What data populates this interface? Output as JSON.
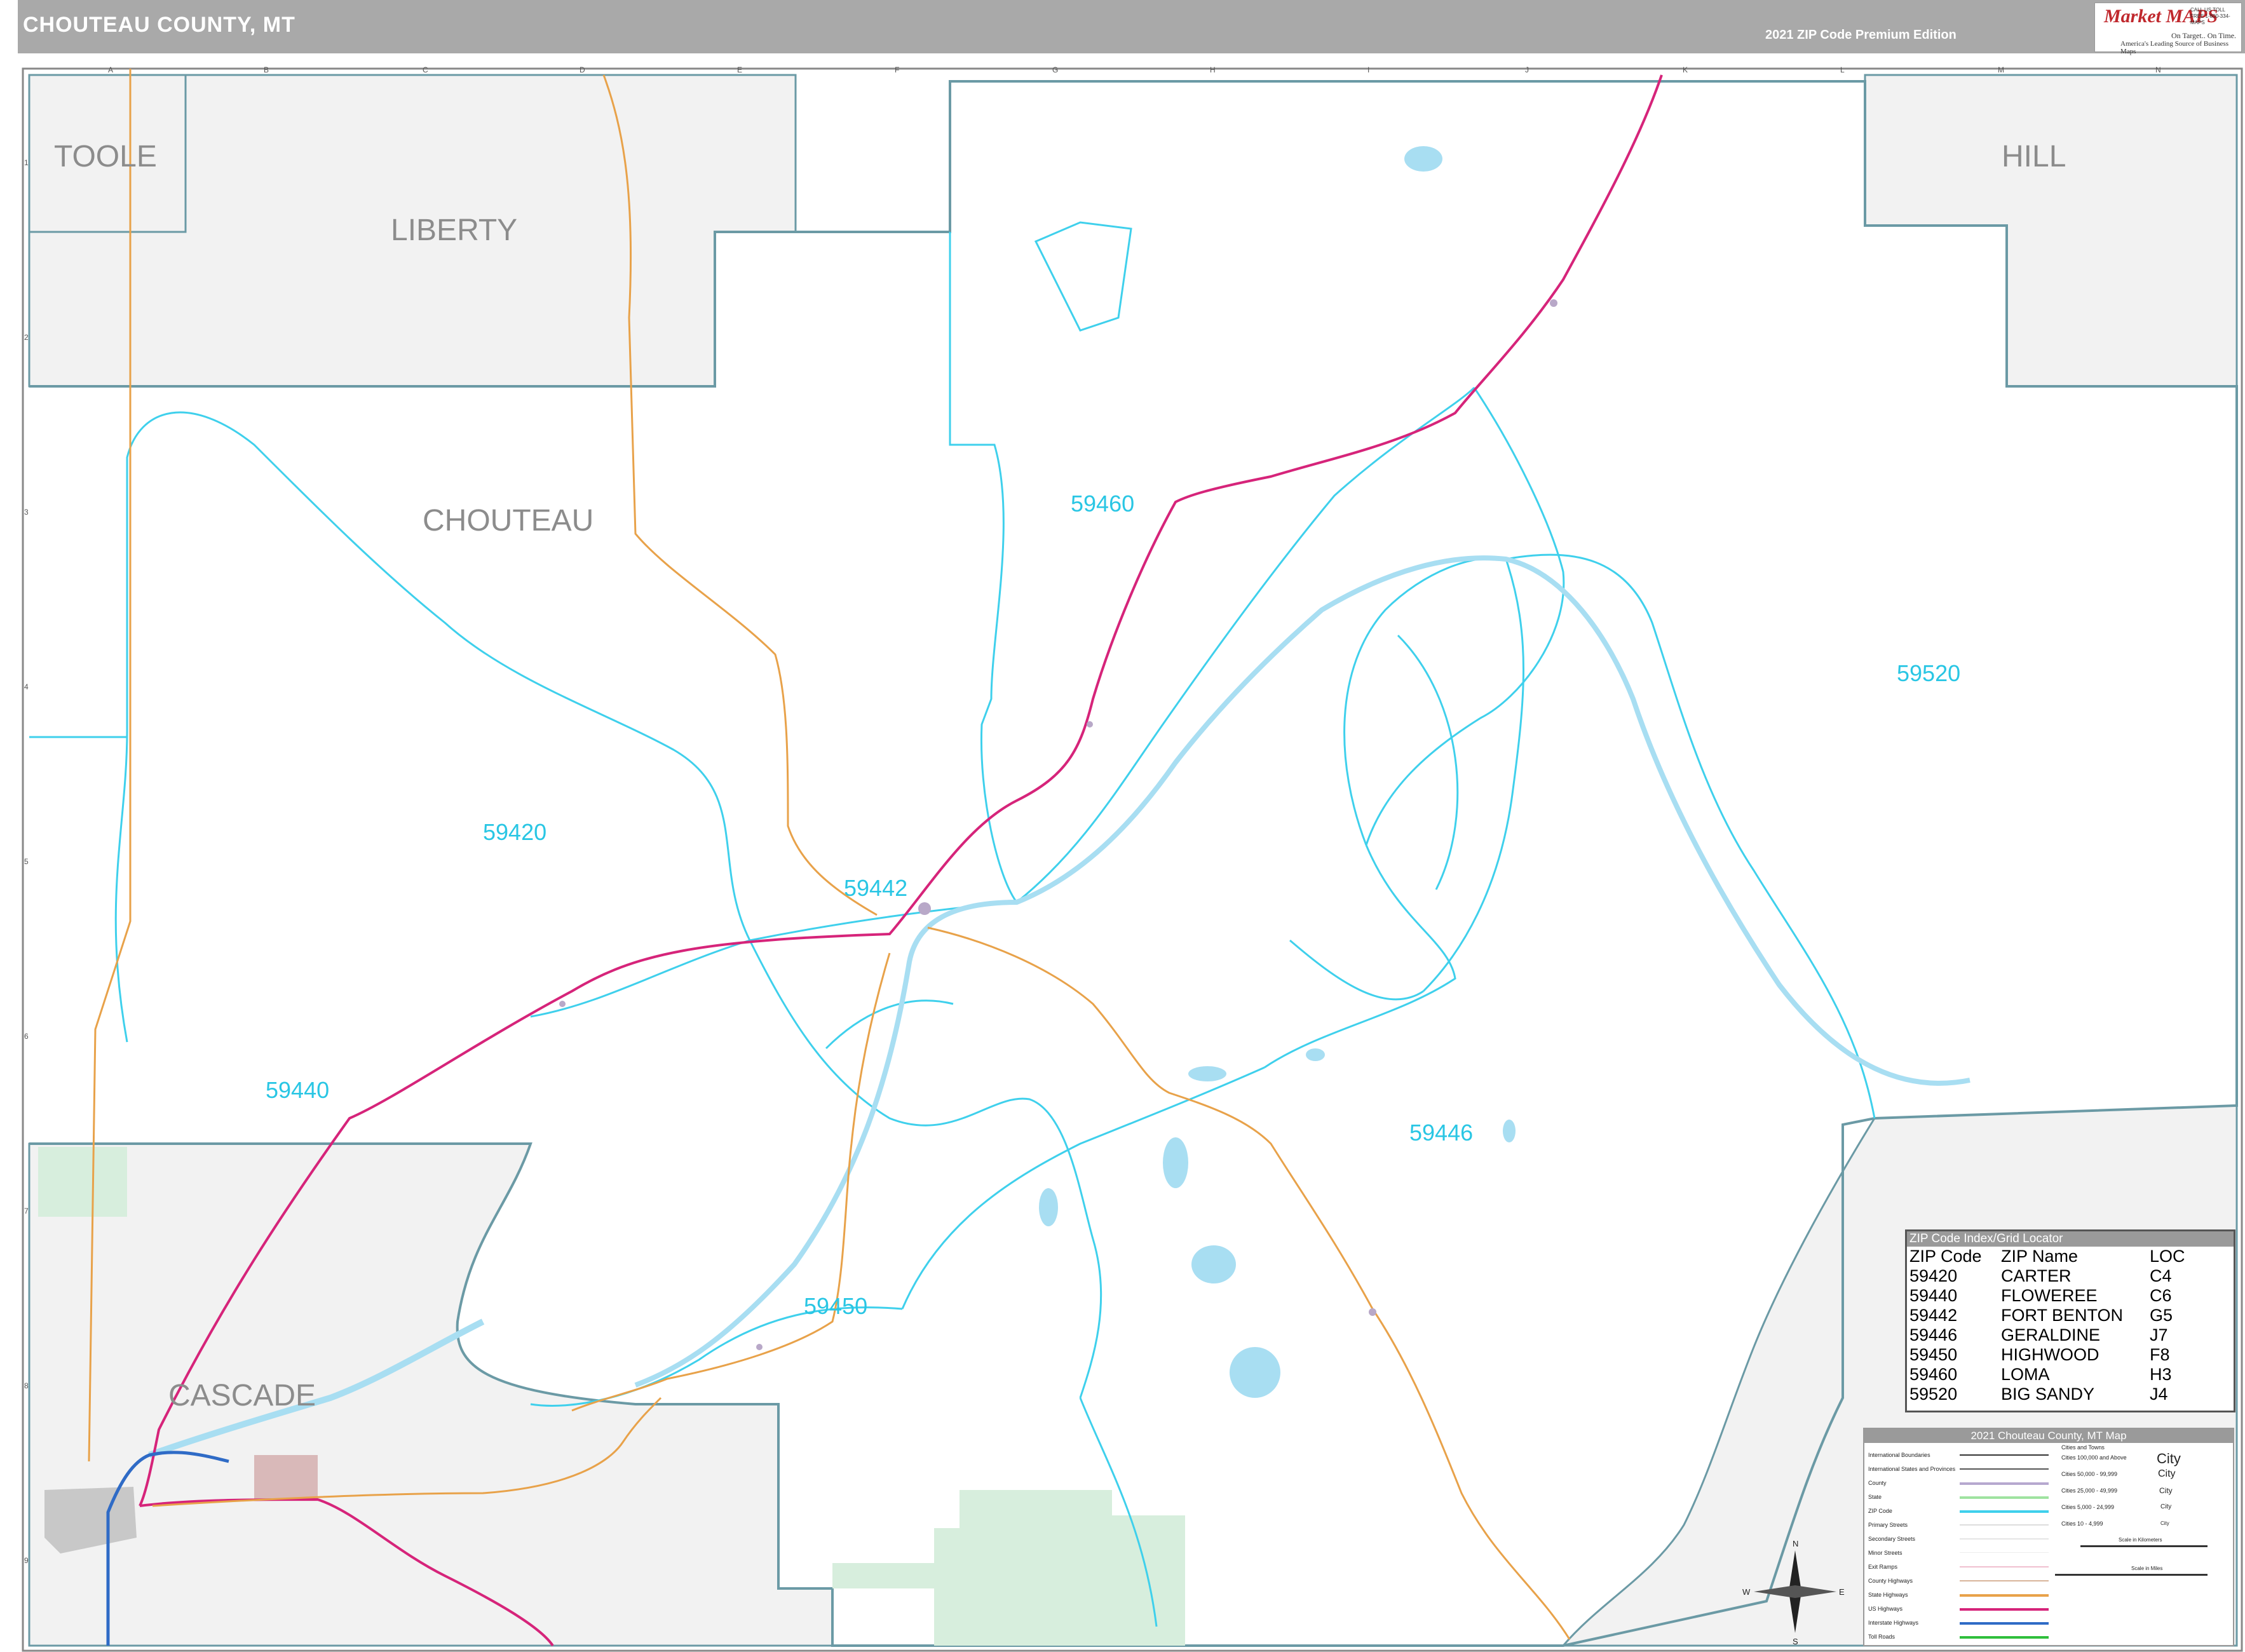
{
  "header": {
    "title": "CHOUTEAU COUNTY, MT",
    "edition": "2021 ZIP Code Premium Edition",
    "brand": "Market MAPS",
    "brand_tagline": "On Target.. On Time.",
    "brand_tagline2": "America's Leading Source of Business Maps",
    "brand_contact": "CALL US TOLL FREE 1-800-334-MAPS"
  },
  "grid": {
    "letters": [
      "A",
      "B",
      "C",
      "D",
      "E",
      "F",
      "G",
      "H",
      "I",
      "J",
      "K",
      "L",
      "M",
      "N"
    ],
    "numbers": [
      "1",
      "2",
      "3",
      "4",
      "5",
      "6",
      "7",
      "8",
      "9"
    ]
  },
  "counties": [
    "TOOLE",
    "LIBERTY",
    "HILL",
    "CHOUTEAU",
    "CASCADE"
  ],
  "zip_labels": [
    "59460",
    "59520",
    "59420",
    "59442",
    "59440",
    "59446",
    "59450"
  ],
  "zip_index": {
    "title": "ZIP Code Index/Grid Locator",
    "columns": [
      "ZIP Code",
      "ZIP Name",
      "LOC"
    ],
    "rows": [
      [
        "59420",
        "CARTER",
        "C4"
      ],
      [
        "59440",
        "FLOWEREE",
        "C6"
      ],
      [
        "59442",
        "FORT BENTON",
        "G5"
      ],
      [
        "59446",
        "GERALDINE",
        "J7"
      ],
      [
        "59450",
        "HIGHWOOD",
        "F8"
      ],
      [
        "59460",
        "LOMA",
        "H3"
      ],
      [
        "59520",
        "BIG SANDY",
        "J4"
      ]
    ]
  },
  "legend": {
    "title": "2021 Chouteau County, MT Map",
    "left_items": [
      "International Boundaries",
      "International States and Provinces",
      "County",
      "State",
      "ZIP Code",
      "Primary Streets",
      "Secondary Streets",
      "Minor Streets",
      "Exit Ramps",
      "County Highways",
      "State Highways",
      "US Highways",
      "Interstate Highways",
      "Toll Roads"
    ],
    "right_title": "Cities and Towns",
    "right_items": [
      {
        "label": "Cities 100,000 and Above",
        "sample": "City"
      },
      {
        "label": "Cities 50,000 - 99,999",
        "sample": "City"
      },
      {
        "label": "Cities 25,000 - 49,999",
        "sample": "City"
      },
      {
        "label": "Cities 5,000 - 24,999",
        "sample": "City"
      },
      {
        "label": "Cities 10 - 4,999",
        "sample": "City"
      }
    ],
    "scale_km": "Scale in Kilometers",
    "scale_mi": "Scale in Miles",
    "compass": [
      "N",
      "E",
      "S",
      "W"
    ]
  },
  "colors": {
    "zip_boundary": "#3fd0ec",
    "water": "#a8def2",
    "us_highway": "#d6247a",
    "state_highway": "#e8a24a",
    "county_line": "#6b9aa5",
    "outside_county": "#f2f2f2",
    "park": "#d7eedd"
  }
}
